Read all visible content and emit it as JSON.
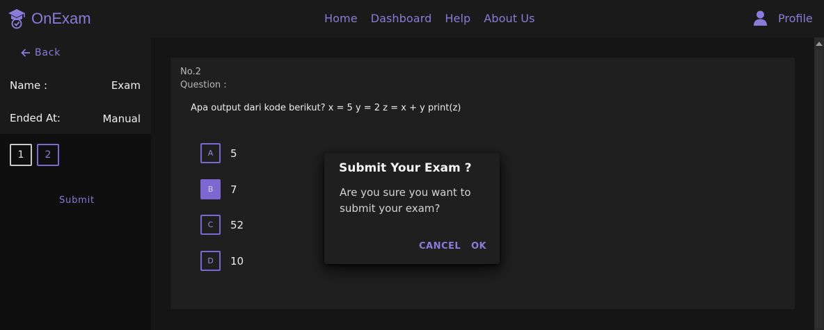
{
  "header": {
    "brand": "OnExam",
    "nav": [
      "Home",
      "Dashboard",
      "Help",
      "About Us"
    ],
    "profile_label": "Profile"
  },
  "sidebar": {
    "back_label": "Back",
    "name_label": "Name :",
    "name_value": "Exam",
    "ended_label": "Ended At:",
    "ended_value": "Manual",
    "question_numbers": [
      "1",
      "2"
    ],
    "submit_label": "Submit"
  },
  "question": {
    "number": "No.2",
    "label": "Question :",
    "text": "Apa output dari kode berikut? x = 5 y = 2 z = x + y print(z)",
    "options": [
      {
        "letter": "A",
        "text": "5"
      },
      {
        "letter": "B",
        "text": "7"
      },
      {
        "letter": "C",
        "text": "52"
      },
      {
        "letter": "D",
        "text": "10"
      }
    ],
    "selected": "B"
  },
  "dialog": {
    "title": "Submit Your Exam ?",
    "body": "Are you sure you want to submit your exam?",
    "cancel_label": "CANCEL",
    "ok_label": "OK"
  },
  "colors": {
    "accent": "#7b68d0",
    "accent_text": "#8b7bd8",
    "background": "#0f0f0f",
    "panel": "#1a1a1a",
    "card": "#1f1f1f"
  }
}
